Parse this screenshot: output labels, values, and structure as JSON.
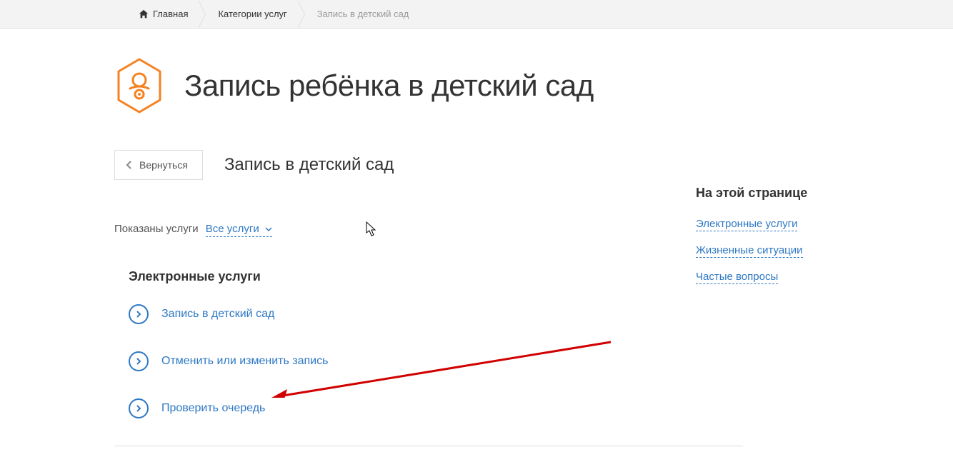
{
  "breadcrumb": {
    "home": "Главная",
    "categories": "Категории услуг",
    "current": "Запись в детский сад"
  },
  "header": {
    "title": "Запись ребёнка в детский сад"
  },
  "subheader": {
    "back_label": "Вернуться",
    "subtitle": "Запись в детский сад"
  },
  "filter": {
    "label": "Показаны услуги",
    "selected": "Все услуги"
  },
  "section": {
    "heading": "Электронные услуги",
    "items": [
      {
        "label": "Запись в детский сад"
      },
      {
        "label": "Отменить или изменить запись"
      },
      {
        "label": "Проверить очередь"
      }
    ]
  },
  "sidebar": {
    "title": "На этой странице",
    "links": [
      {
        "label": "Электронные услуги"
      },
      {
        "label": "Жизненные ситуации"
      },
      {
        "label": "Частые вопросы"
      }
    ]
  }
}
